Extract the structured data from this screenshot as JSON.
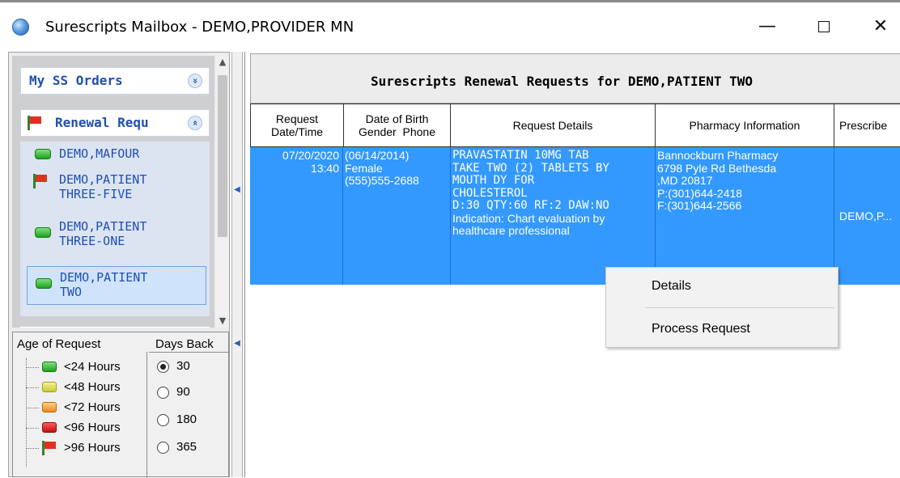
{
  "window": {
    "title": "Surescripts Mailbox - DEMO,PROVIDER MN",
    "controls": {
      "minimize": "—",
      "close": "✕"
    }
  },
  "sidebar": {
    "groups": [
      {
        "label": "My SS Orders",
        "chevron": "»"
      },
      {
        "label": "Renewal Requ",
        "chevron": "«",
        "items": [
          {
            "name": "DEMO,MAFOUR",
            "status": "green"
          },
          {
            "name_line1": "DEMO,PATIENT",
            "name_line2": "THREE-FIVE",
            "status": "red-flag"
          },
          {
            "name_line1": "DEMO,PATIENT",
            "name_line2": "THREE-ONE",
            "status": "green"
          },
          {
            "name_line1": "DEMO,PATIENT",
            "name_line2": "TWO",
            "status": "green",
            "selected": true
          }
        ]
      }
    ],
    "scroll_up": "▲",
    "scroll_down": "▼"
  },
  "legend": {
    "age_title": "Age of Request",
    "days_title": "Days Back",
    "ages": [
      {
        "label": "<24 Hours",
        "color": "#22b022"
      },
      {
        "label": "<48 Hours",
        "color": "#d9d93a"
      },
      {
        "label": "<72 Hours",
        "color": "#f09a2a"
      },
      {
        "label": "<96 Hours",
        "color": "#d41c1c"
      },
      {
        "label": ">96 Hours",
        "color": "flag"
      }
    ],
    "days": [
      {
        "label": "30",
        "checked": true
      },
      {
        "label": "90",
        "checked": false
      },
      {
        "label": "180",
        "checked": false
      },
      {
        "label": "365",
        "checked": false
      }
    ]
  },
  "main": {
    "title": "Surescripts Renewal Requests for DEMO,PATIENT TWO",
    "columns": [
      {
        "line1": "Request",
        "line2": "Date/Time"
      },
      {
        "line1": "Date of Birth",
        "line2": "Gender  Phone"
      },
      {
        "line1": "Request Details",
        "line2": ""
      },
      {
        "line1": "Pharmacy Information",
        "line2": ""
      },
      {
        "line1": "Prescribe",
        "line2": ""
      }
    ],
    "row": {
      "date": "07/20/2020",
      "time": "13:40",
      "dob": "(06/14/2014)",
      "gender": "Female",
      "phone": "(555)555-2688",
      "details": [
        "PRAVASTATIN 10MG TAB",
        "TAKE TWO (2) TABLETS BY",
        "MOUTH DY FOR",
        "CHOLESTEROL",
        "D:30 QTY:60 RF:2 DAW:NO",
        "Indication: Chart evaluation by",
        "healthcare professional"
      ],
      "pharmacy": [
        "Bannockburn Pharmacy",
        "6798 Pyle Rd Bethesda",
        ",MD 20817",
        "P:(301)644-2418",
        "F:(301)644-2566"
      ],
      "prescriber": "DEMO,P..."
    },
    "row_color": "#3399ff"
  },
  "context_menu": {
    "items": [
      "Details",
      "Process Request"
    ]
  }
}
